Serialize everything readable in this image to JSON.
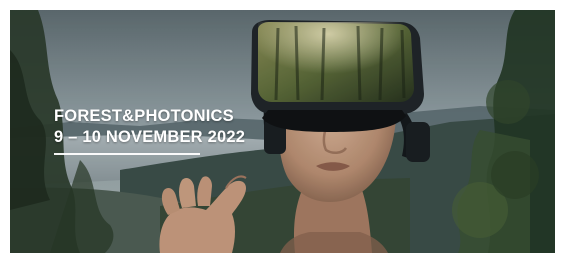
{
  "banner": {
    "title": "FOREST&PHOTONICS",
    "dates": "9 – 10  NOVEMBER 2022"
  },
  "image": {
    "subject": "person-wearing-vr-headset",
    "background": "forest-lake-landscape"
  },
  "colors": {
    "text": "#ffffff",
    "headset": "#1e2327",
    "sky": "#8f9da3",
    "forest": "#2f4a32"
  }
}
